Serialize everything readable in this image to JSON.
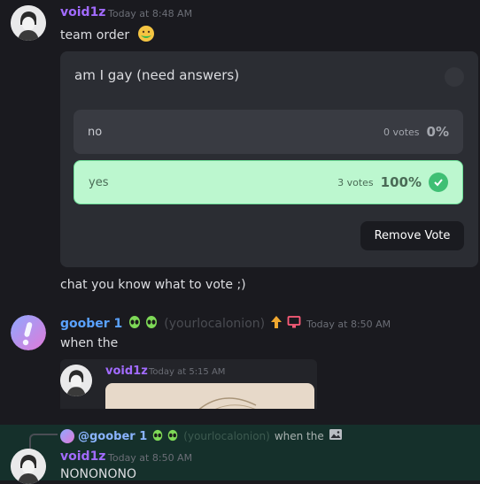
{
  "messages": [
    {
      "username": "void1z",
      "username_color": "#a26bff",
      "timestamp": "Today at 8:48 AM",
      "text": "team order",
      "emoji_icon": "nauseated-face-icon"
    },
    {
      "text": "chat you know what to vote ;)"
    },
    {
      "username": "goober 1",
      "username_color": "#5aa2ff",
      "badges": [
        "alien-icon",
        "alien-icon"
      ],
      "pronouns": "(yourlocalonion)",
      "role_icons": [
        "up-arrow-icon",
        "monitor-icon"
      ],
      "timestamp": "Today at 8:50 AM",
      "text": "when the",
      "embed": {
        "username": "void1z",
        "timestamp": "Today at 5:15 AM"
      }
    },
    {
      "reply": {
        "mention": "@goober 1",
        "pronouns": "(yourlocalonion)",
        "text": "when the",
        "image_icon": "image-icon"
      },
      "username": "void1z",
      "timestamp": "Today at 8:50 AM",
      "text": "NONONONO"
    }
  ],
  "poll": {
    "question": "am I gay (need answers)",
    "options": [
      {
        "label": "no",
        "votes": "0 votes",
        "percent": "0%",
        "selected": false
      },
      {
        "label": "yes",
        "votes": "3 votes",
        "percent": "100%",
        "selected": true
      }
    ],
    "remove_vote_label": "Remove Vote",
    "accent_color": "#3fbf74"
  }
}
